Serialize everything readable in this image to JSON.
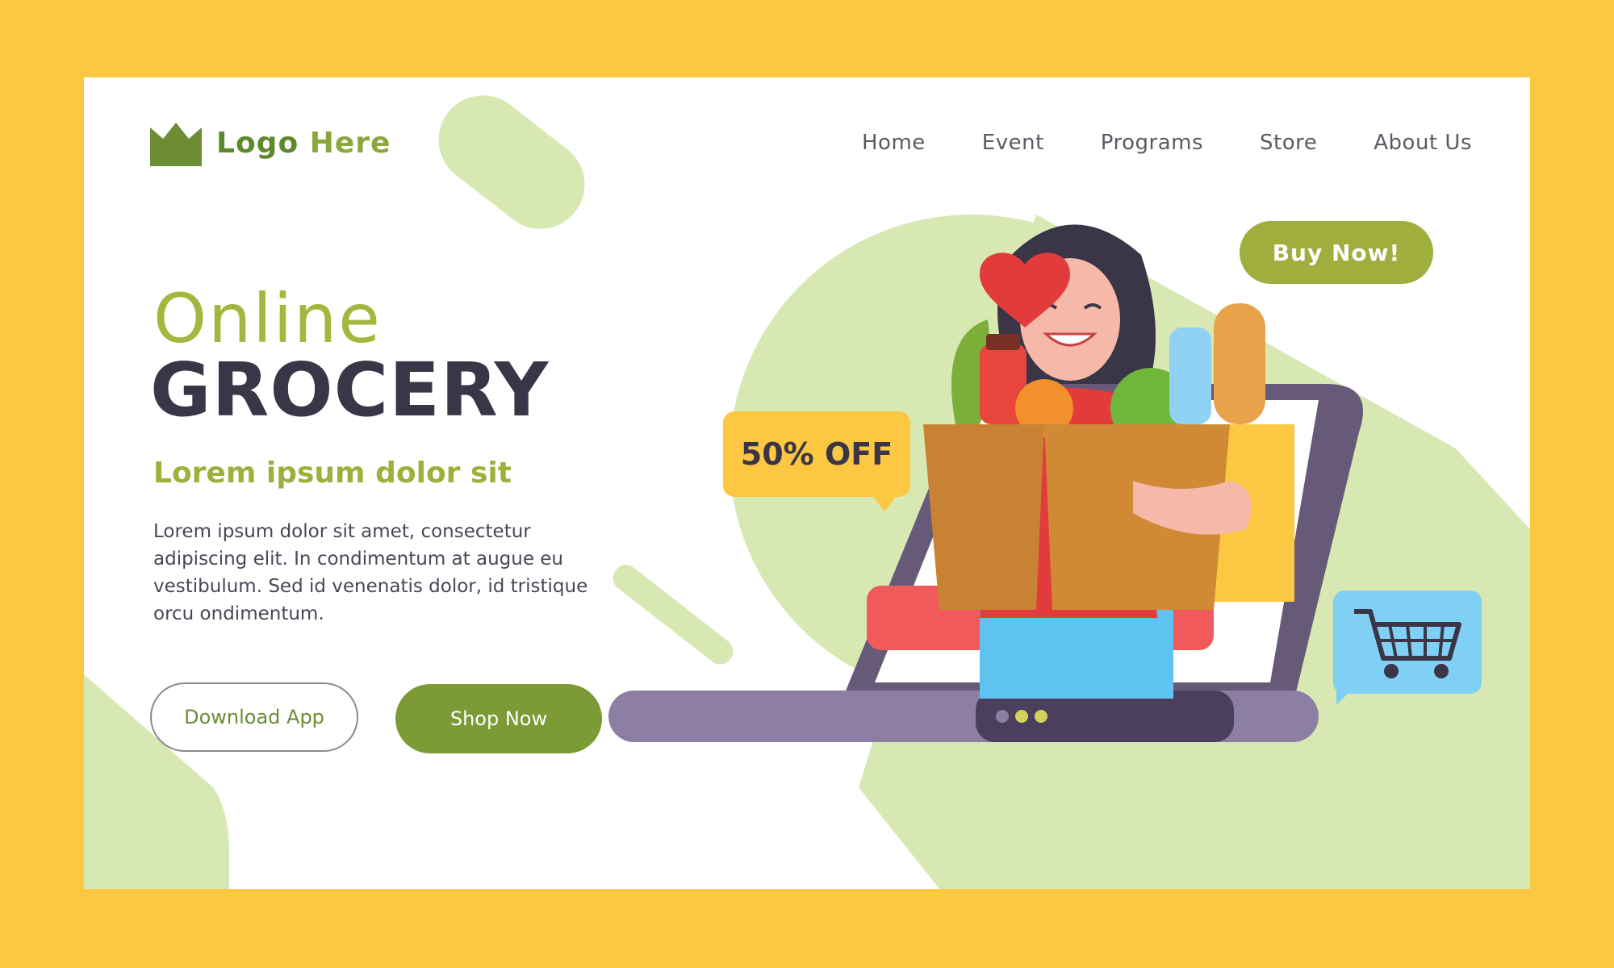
{
  "logo": {
    "word1": "Logo",
    "word2": "Here",
    "icon": "crown-icon"
  },
  "nav": {
    "items": [
      {
        "label": "Home"
      },
      {
        "label": "Event"
      },
      {
        "label": "Programs"
      },
      {
        "label": "Store"
      },
      {
        "label": "About Us"
      }
    ]
  },
  "hero": {
    "line1": "Online",
    "line2": "GROCERY",
    "subtitle": "Lorem ipsum dolor sit",
    "body": "Lorem ipsum dolor sit amet, consectetur adipiscing elit. In condimentum at augue eu vestibulum. Sed id venenatis dolor, id tristique orcu ondimentum."
  },
  "buttons": {
    "download": "Download App",
    "shop": "Shop Now",
    "buy": "Buy Now!"
  },
  "offer": {
    "label": "50% OFF"
  },
  "icons": {
    "cart": "shopping-cart-icon",
    "heart": "heart-icon"
  },
  "colors": {
    "background": "#fcc842",
    "accent_green": "#7c9a35",
    "light_green": "#d7e8b2",
    "dark_text": "#3b3548",
    "cart_blue": "#7fd0f4"
  }
}
